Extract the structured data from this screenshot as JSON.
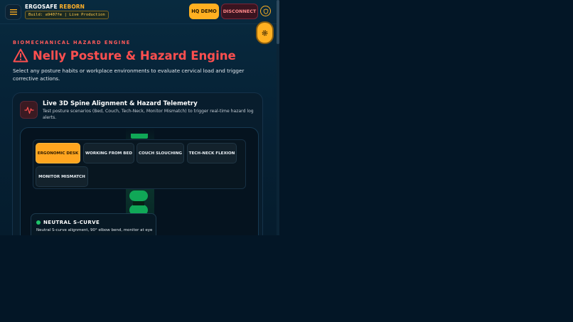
{
  "app": {
    "brand_part1": "ERGOSAFE",
    "brand_part2": "REBORN",
    "build": "Build: a9407fe | Live Production"
  },
  "topbar": {
    "hq_label": "HQ DEMO",
    "disconnect_label": "DISCONNECT"
  },
  "header": {
    "eyebrow": "BIOMECHANICAL HAZARD ENGINE",
    "title": "Nelly Posture & Hazard Engine",
    "subtitle": "Select any posture habits or workplace environments to evaluate cervical load and trigger corrective actions."
  },
  "card": {
    "title": "Live 3D Spine Alignment & Hazard Telemetry",
    "description": "Test posture scenarios (Bed, Couch, Tech-Neck, Monitor Mismatch) to trigger real-time hazard log alerts."
  },
  "postures": [
    {
      "label": "ERGONOMIC DESK",
      "active": true
    },
    {
      "label": "WORKING FROM BED",
      "active": false
    },
    {
      "label": "COUCH SLOUCHING",
      "active": false
    },
    {
      "label": "TECH-NECK FLEXION",
      "active": false
    },
    {
      "label": "MONITOR MISMATCH",
      "active": false
    }
  ],
  "status": {
    "title": "NEUTRAL S-CURVE",
    "description": "Neutral S-curve alignment, 90° elbow bend, monitor at eye"
  },
  "colors": {
    "accent": "#ffb021",
    "hazard": "#ff4f4f",
    "spine": "#10a857",
    "background": "#031626"
  },
  "icons": [
    "menu-icon",
    "shield-icon",
    "gear-icon",
    "warning-triangle-icon",
    "pulse-icon"
  ]
}
